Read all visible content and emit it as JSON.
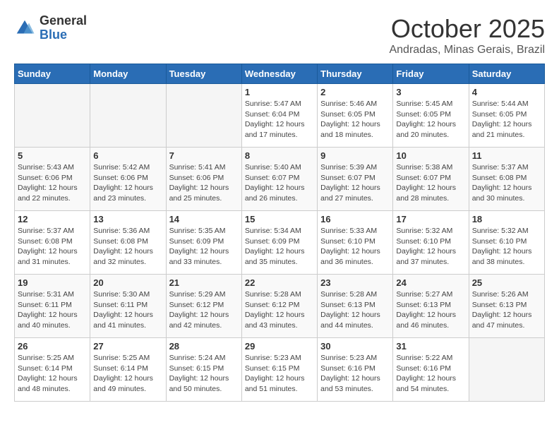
{
  "header": {
    "logo_line1": "General",
    "logo_line2": "Blue",
    "month": "October 2025",
    "location": "Andradas, Minas Gerais, Brazil"
  },
  "weekdays": [
    "Sunday",
    "Monday",
    "Tuesday",
    "Wednesday",
    "Thursday",
    "Friday",
    "Saturday"
  ],
  "weeks": [
    [
      {
        "day": "",
        "info": ""
      },
      {
        "day": "",
        "info": ""
      },
      {
        "day": "",
        "info": ""
      },
      {
        "day": "1",
        "info": "Sunrise: 5:47 AM\nSunset: 6:04 PM\nDaylight: 12 hours and 17 minutes."
      },
      {
        "day": "2",
        "info": "Sunrise: 5:46 AM\nSunset: 6:05 PM\nDaylight: 12 hours and 18 minutes."
      },
      {
        "day": "3",
        "info": "Sunrise: 5:45 AM\nSunset: 6:05 PM\nDaylight: 12 hours and 20 minutes."
      },
      {
        "day": "4",
        "info": "Sunrise: 5:44 AM\nSunset: 6:05 PM\nDaylight: 12 hours and 21 minutes."
      }
    ],
    [
      {
        "day": "5",
        "info": "Sunrise: 5:43 AM\nSunset: 6:06 PM\nDaylight: 12 hours and 22 minutes."
      },
      {
        "day": "6",
        "info": "Sunrise: 5:42 AM\nSunset: 6:06 PM\nDaylight: 12 hours and 23 minutes."
      },
      {
        "day": "7",
        "info": "Sunrise: 5:41 AM\nSunset: 6:06 PM\nDaylight: 12 hours and 25 minutes."
      },
      {
        "day": "8",
        "info": "Sunrise: 5:40 AM\nSunset: 6:07 PM\nDaylight: 12 hours and 26 minutes."
      },
      {
        "day": "9",
        "info": "Sunrise: 5:39 AM\nSunset: 6:07 PM\nDaylight: 12 hours and 27 minutes."
      },
      {
        "day": "10",
        "info": "Sunrise: 5:38 AM\nSunset: 6:07 PM\nDaylight: 12 hours and 28 minutes."
      },
      {
        "day": "11",
        "info": "Sunrise: 5:37 AM\nSunset: 6:08 PM\nDaylight: 12 hours and 30 minutes."
      }
    ],
    [
      {
        "day": "12",
        "info": "Sunrise: 5:37 AM\nSunset: 6:08 PM\nDaylight: 12 hours and 31 minutes."
      },
      {
        "day": "13",
        "info": "Sunrise: 5:36 AM\nSunset: 6:08 PM\nDaylight: 12 hours and 32 minutes."
      },
      {
        "day": "14",
        "info": "Sunrise: 5:35 AM\nSunset: 6:09 PM\nDaylight: 12 hours and 33 minutes."
      },
      {
        "day": "15",
        "info": "Sunrise: 5:34 AM\nSunset: 6:09 PM\nDaylight: 12 hours and 35 minutes."
      },
      {
        "day": "16",
        "info": "Sunrise: 5:33 AM\nSunset: 6:10 PM\nDaylight: 12 hours and 36 minutes."
      },
      {
        "day": "17",
        "info": "Sunrise: 5:32 AM\nSunset: 6:10 PM\nDaylight: 12 hours and 37 minutes."
      },
      {
        "day": "18",
        "info": "Sunrise: 5:32 AM\nSunset: 6:10 PM\nDaylight: 12 hours and 38 minutes."
      }
    ],
    [
      {
        "day": "19",
        "info": "Sunrise: 5:31 AM\nSunset: 6:11 PM\nDaylight: 12 hours and 40 minutes."
      },
      {
        "day": "20",
        "info": "Sunrise: 5:30 AM\nSunset: 6:11 PM\nDaylight: 12 hours and 41 minutes."
      },
      {
        "day": "21",
        "info": "Sunrise: 5:29 AM\nSunset: 6:12 PM\nDaylight: 12 hours and 42 minutes."
      },
      {
        "day": "22",
        "info": "Sunrise: 5:28 AM\nSunset: 6:12 PM\nDaylight: 12 hours and 43 minutes."
      },
      {
        "day": "23",
        "info": "Sunrise: 5:28 AM\nSunset: 6:13 PM\nDaylight: 12 hours and 44 minutes."
      },
      {
        "day": "24",
        "info": "Sunrise: 5:27 AM\nSunset: 6:13 PM\nDaylight: 12 hours and 46 minutes."
      },
      {
        "day": "25",
        "info": "Sunrise: 5:26 AM\nSunset: 6:13 PM\nDaylight: 12 hours and 47 minutes."
      }
    ],
    [
      {
        "day": "26",
        "info": "Sunrise: 5:25 AM\nSunset: 6:14 PM\nDaylight: 12 hours and 48 minutes."
      },
      {
        "day": "27",
        "info": "Sunrise: 5:25 AM\nSunset: 6:14 PM\nDaylight: 12 hours and 49 minutes."
      },
      {
        "day": "28",
        "info": "Sunrise: 5:24 AM\nSunset: 6:15 PM\nDaylight: 12 hours and 50 minutes."
      },
      {
        "day": "29",
        "info": "Sunrise: 5:23 AM\nSunset: 6:15 PM\nDaylight: 12 hours and 51 minutes."
      },
      {
        "day": "30",
        "info": "Sunrise: 5:23 AM\nSunset: 6:16 PM\nDaylight: 12 hours and 53 minutes."
      },
      {
        "day": "31",
        "info": "Sunrise: 5:22 AM\nSunset: 6:16 PM\nDaylight: 12 hours and 54 minutes."
      },
      {
        "day": "",
        "info": ""
      }
    ]
  ]
}
